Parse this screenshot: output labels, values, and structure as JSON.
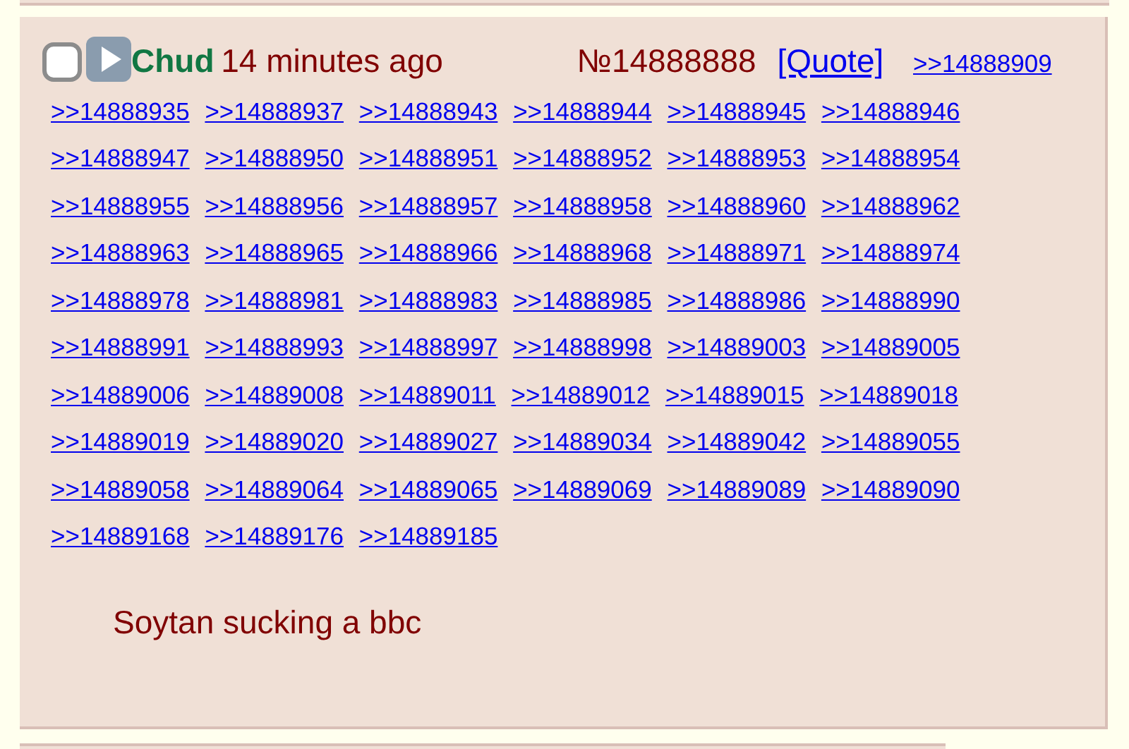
{
  "post": {
    "checked": false,
    "name": "Chud",
    "time": "14 minutes ago",
    "number": "№14888888",
    "quote": "[Quote]",
    "replies": [
      ">>14888909",
      ">>14888935",
      ">>14888937",
      ">>14888943",
      ">>14888944",
      ">>14888945",
      ">>14888946",
      ">>14888947",
      ">>14888950",
      ">>14888951",
      ">>14888952",
      ">>14888953",
      ">>14888954",
      ">>14888955",
      ">>14888956",
      ">>14888957",
      ">>14888958",
      ">>14888960",
      ">>14888962",
      ">>14888963",
      ">>14888965",
      ">>14888966",
      ">>14888968",
      ">>14888971",
      ">>14888974",
      ">>14888978",
      ">>14888981",
      ">>14888983",
      ">>14888985",
      ">>14888986",
      ">>14888990",
      ">>14888991",
      ">>14888993",
      ">>14888997",
      ">>14888998",
      ">>14889003",
      ">>14889005",
      ">>14889006",
      ">>14889008",
      ">>14889011",
      ">>14889012",
      ">>14889015",
      ">>14889018",
      ">>14889019",
      ">>14889020",
      ">>14889027",
      ">>14889034",
      ">>14889042",
      ">>14889055",
      ">>14889058",
      ">>14889064",
      ">>14889065",
      ">>14889069",
      ">>14889089",
      ">>14889090",
      ">>14889168",
      ">>14889176",
      ">>14889185"
    ],
    "message": "Soytan sucking a bbc"
  }
}
